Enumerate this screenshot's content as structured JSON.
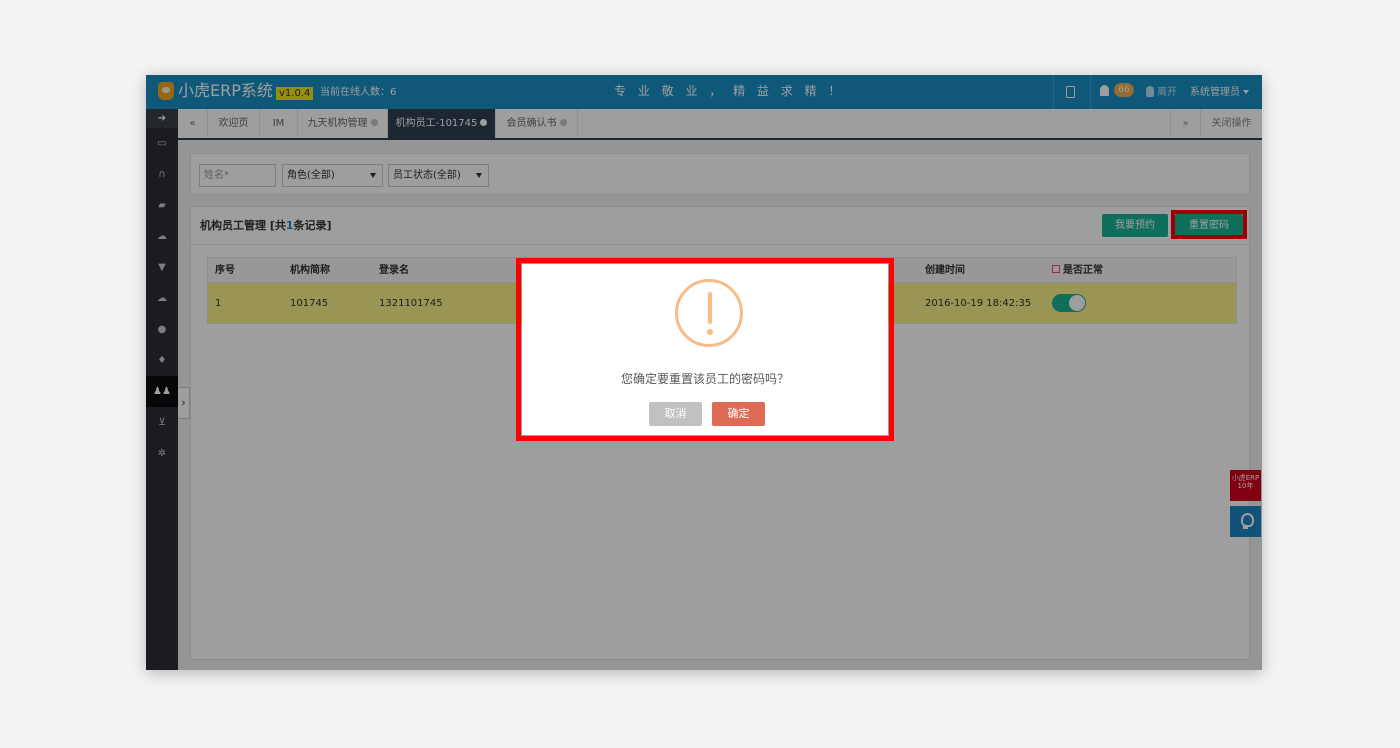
{
  "header": {
    "brand": "小虎ERP系统",
    "version": "v1.0.4",
    "online_label": "当前在线人数：6",
    "slogan": "专 业 敬 业 ， 精 益 求 精 ！",
    "notification_count": "66",
    "leave_label": "离开",
    "user_label": "系统管理员",
    "icons": [
      "document-icon",
      "bell-icon",
      "user-icon",
      "caret-down-icon"
    ]
  },
  "sidebar": {
    "icons": [
      "arrow-right-icon",
      "monitor-icon",
      "headset-icon",
      "book-icon",
      "cloud-icon",
      "filter-icon",
      "cloud-upload-icon",
      "globe-icon",
      "thumbs-up-icon",
      "users-icon",
      "cart-icon",
      "gear-icon"
    ],
    "active": "users-icon",
    "toggle_glyph": "›"
  },
  "tabs": {
    "prev": "«",
    "items": [
      {
        "label": "欢迎页",
        "closable": false,
        "active": false
      },
      {
        "label": "IM",
        "closable": false,
        "active": false
      },
      {
        "label": "九天机构管理",
        "closable": true,
        "active": false
      },
      {
        "label": "机构员工-101745",
        "closable": true,
        "active": true
      },
      {
        "label": "会员确认书",
        "closable": true,
        "active": false
      }
    ],
    "next": "»",
    "close_ops": "关闭操作"
  },
  "filters": {
    "name_placeholder": "姓名*",
    "role_select": "角色(全部)",
    "status_select": "员工状态(全部)"
  },
  "panel": {
    "title_prefix": "机构员工管理 [共",
    "count": "1",
    "title_suffix": "条记录]",
    "btn_appointment": "我要预约",
    "btn_reset": "重置密码"
  },
  "table": {
    "headers": [
      "序号",
      "机构简称",
      "登录名",
      "创建时间",
      "是否正常"
    ],
    "rows": [
      {
        "index": "1",
        "org": "101745",
        "login": "1321101745",
        "created": "2016-10-19 18:42:35",
        "active": true
      }
    ]
  },
  "widgets": {
    "promo_text": "小虎ERP 10年"
  },
  "modal": {
    "message": "您确定要重置该员工的密码吗？",
    "cancel": "取消",
    "confirm": "确定"
  },
  "colors": {
    "header_bg": "#1a8fc4",
    "sidebar_bg": "#2a2e33",
    "accent_green": "#1ab394",
    "row_highlight": "#fbf08a",
    "confirm_btn": "#dd6b55",
    "warning": "#f8bb86",
    "annotation_red": "#ff0000"
  }
}
